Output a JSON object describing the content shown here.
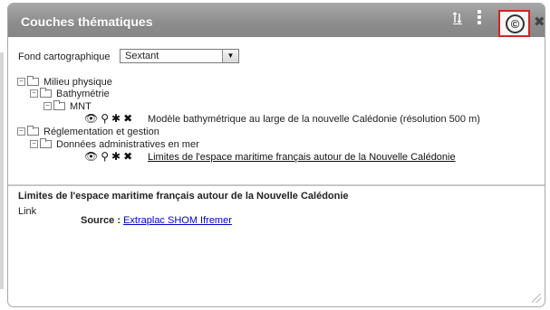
{
  "window": {
    "title": "Couches thématiques"
  },
  "toolbar": {
    "sort_icon": "sort-icon",
    "grip_icon": "drag-grip-icon",
    "copyright_glyph": "©",
    "close_glyph": "✖"
  },
  "fond": {
    "label": "Fond cartographique",
    "selected": "Sextant",
    "arrow": "▼"
  },
  "tree": {
    "milieu_physique": "Milieu physique",
    "bathymetrie": "Bathymétrie",
    "mnt": "MNT",
    "modele_bathymetrique": "Modèle bathymétrique au large de la nouvelle Calédonie (résolution 500 m)",
    "reglementation": "Réglementation et gestion",
    "donnees_administratives": "Données administratives en mer",
    "limites_espace": "Limites de l'espace maritime français autour de la Nouvelle Calédonie"
  },
  "actions": {
    "eye": "👁",
    "zoom": "⚲",
    "settings": "✱",
    "remove": "✖"
  },
  "info": {
    "title": "Limites de l'espace maritime français autour de la Nouvelle Calédonie",
    "link_label": "Link",
    "source_label": "Source :",
    "source_link": "Extraplac SHOM Ifremer"
  },
  "colors": {
    "titlebar": "#999999",
    "highlight_border": "#d42323",
    "link": "#0000cc"
  }
}
